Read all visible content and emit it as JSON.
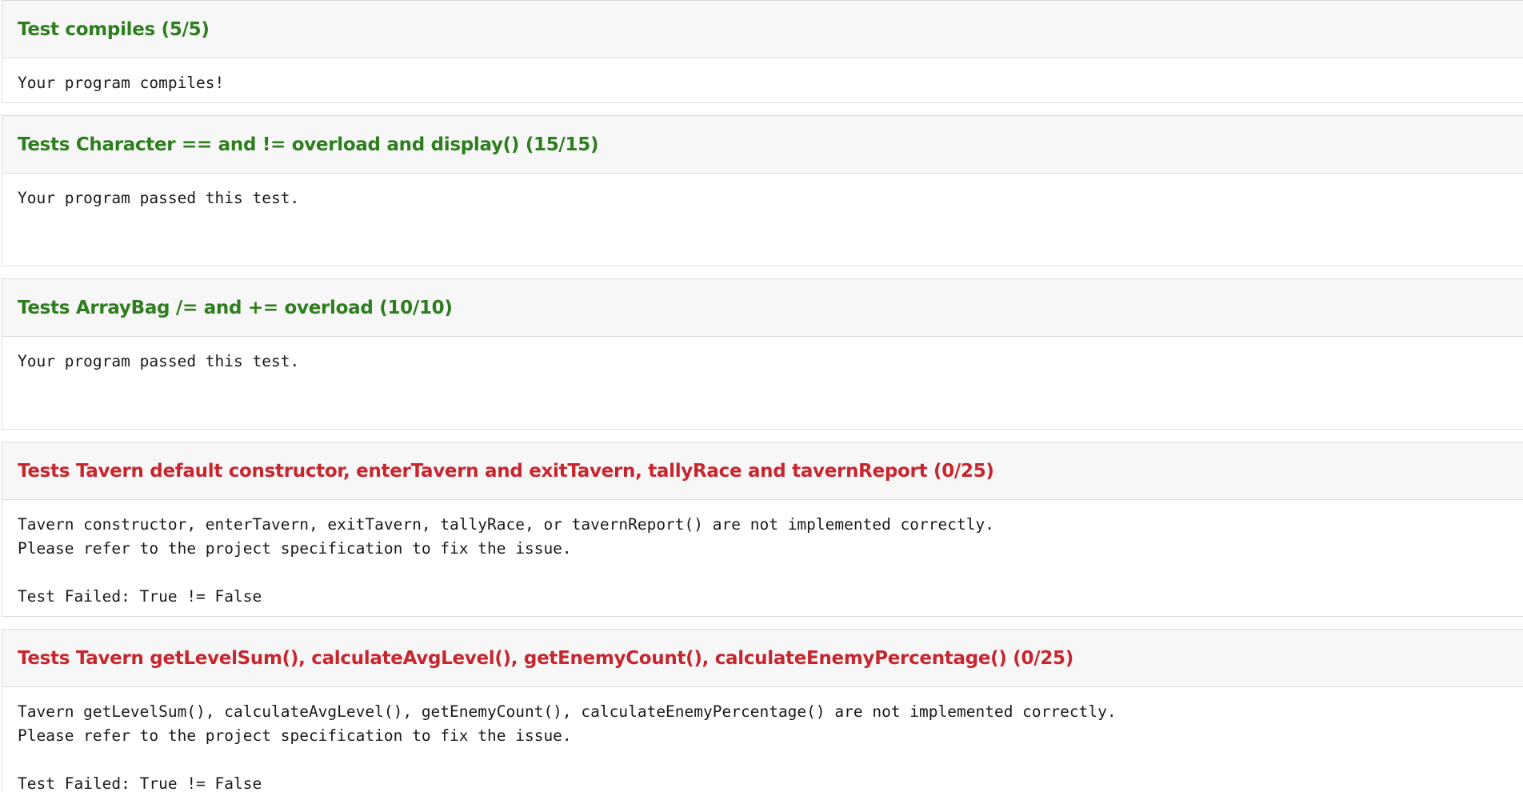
{
  "results": [
    {
      "title": "Test compiles (5/5)",
      "status": "pass",
      "output": [
        "Your program compiles!"
      ]
    },
    {
      "title": "Tests Character == and != overload and display() (15/15)",
      "status": "pass",
      "output": [
        "Your program passed this test."
      ]
    },
    {
      "title": "Tests ArrayBag /= and += overload (10/10)",
      "status": "pass",
      "output": [
        "Your program passed this test."
      ]
    },
    {
      "title": "Tests Tavern default constructor, enterTavern and exitTavern, tallyRace and tavernReport (0/25)",
      "status": "fail",
      "output": [
        "Tavern constructor, enterTavern, exitTavern, tallyRace, or tavernReport() are not implemented correctly.",
        "Please refer to the project specification to fix the issue.",
        "",
        "Test Failed: True != False"
      ]
    },
    {
      "title": "Tests Tavern getLevelSum(), calculateAvgLevel(), getEnemyCount(), calculateEnemyPercentage() (0/25)",
      "status": "fail",
      "output": [
        "Tavern getLevelSum(), calculateAvgLevel(), getEnemyCount(), calculateEnemyPercentage() are not implemented correctly.",
        "Please refer to the project specification to fix the issue.",
        "",
        "Test Failed: True != False"
      ]
    }
  ],
  "colors": {
    "pass": "#2e7d1f",
    "fail": "#c7262e",
    "header_bg": "#f7f7f7",
    "border": "#dcdcdc"
  }
}
